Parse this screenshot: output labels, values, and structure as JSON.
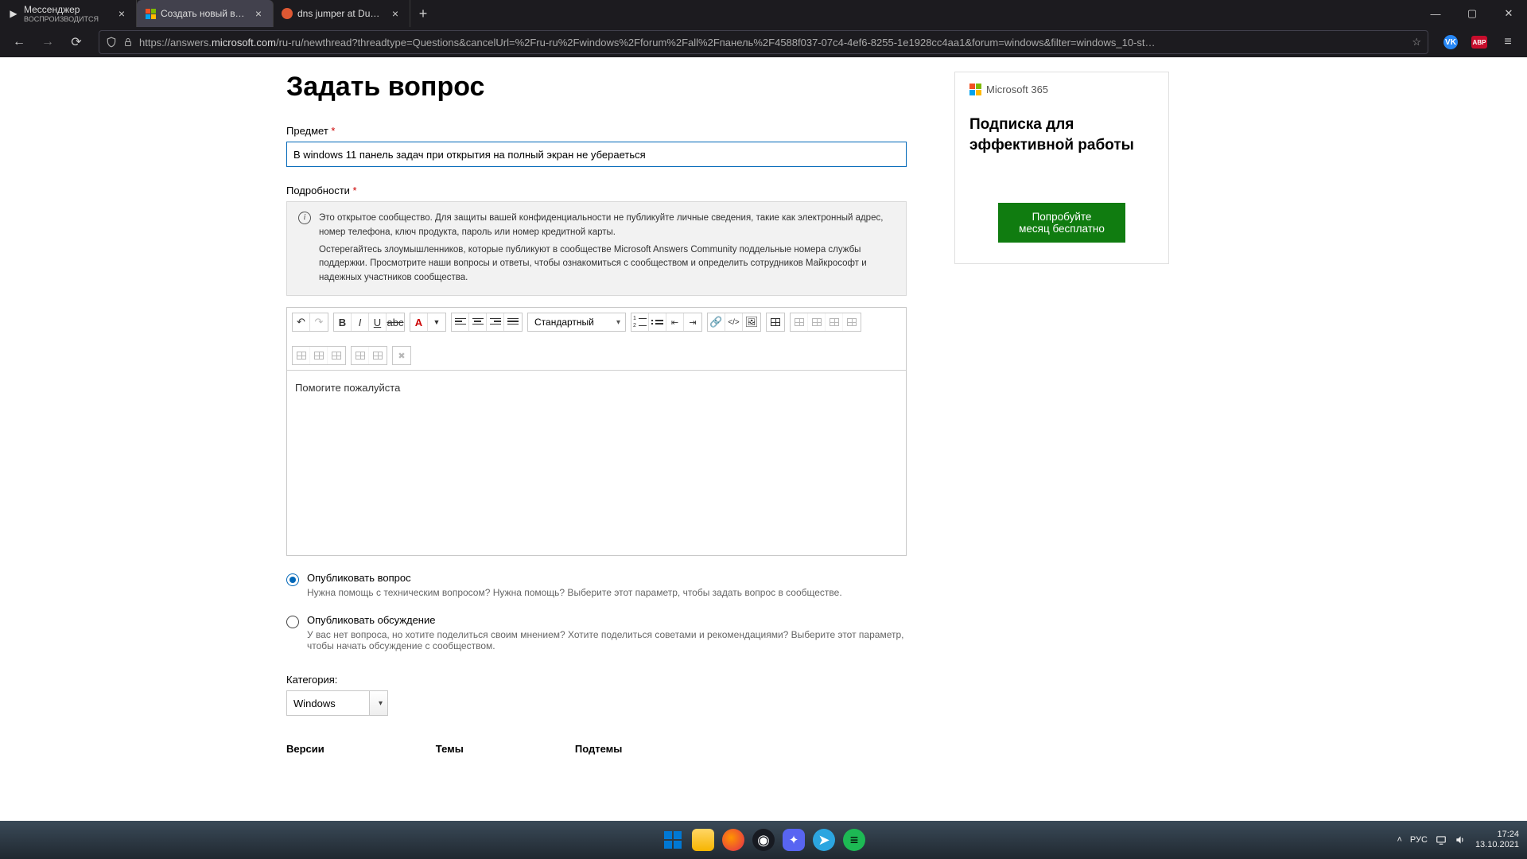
{
  "browser": {
    "tabs": [
      {
        "title": "Мессенджер",
        "subtitle": "ВОСПРОИЗВОДИТСЯ",
        "active": false
      },
      {
        "title": "Создать новый вопрос или н…",
        "active": true
      },
      {
        "title": "dns jumper at DuckDuckGo",
        "active": false
      }
    ],
    "url_prefix": "https://answers.",
    "url_host": "microsoft.com",
    "url_path": "/ru-ru/newthread?threadtype=Questions&cancelUrl=%2Fru-ru%2Fwindows%2Fforum%2Fall%2Fпанель%2F4588f037-07c4-4ef6-8255-1e1928cc4aa1&forum=windows&filter=windows_10-st…"
  },
  "page": {
    "heading": "Задать вопрос",
    "subject_label": "Предмет",
    "subject_value": "В windows 11 панель задач при открытия на полный экран не убераеться",
    "details_label": "Подробности",
    "info_text_1": "Это открытое сообщество. Для защиты вашей конфиденциальности не публикуйте личные сведения, такие как электронный адрес, номер телефона, ключ продукта, пароль или номер кредитной карты.",
    "info_text_2": "Остерегайтесь злоумышленников, которые публикуют в сообществе Microsoft Answers Community поддельные номера службы поддержки.  Просмотрите наши вопросы и ответы, чтобы ознакомиться с сообществом и определить сотрудников Майкрософт и надежных участников сообщества.",
    "format_style": "Стандартный",
    "editor_body": "Помогите пожалуйста",
    "radio1_label": "Опубликовать вопрос",
    "radio1_desc": "Нужна помощь с техническим вопросом? Нужна помощь? Выберите этот параметр, чтобы задать вопрос в сообществе.",
    "radio2_label": "Опубликовать обсуждение",
    "radio2_desc": "У вас нет вопроса, но хотите поделиться своим мнением? Хотите поделиться советами и рекомендациями? Выберите этот параметр, чтобы начать обсуждение с сообществом.",
    "category_label": "Категория:",
    "category_value": "Windows",
    "col1": "Версии",
    "col2": "Темы",
    "col3": "Подтемы"
  },
  "sidebar": {
    "logo_text": "Microsoft 365",
    "headline": "Подписка для эффективной работы",
    "cta": "Попробуйте месяц бесплатно"
  },
  "taskbar": {
    "lang": "РУС",
    "time": "17:24",
    "date": "13.10.2021"
  }
}
